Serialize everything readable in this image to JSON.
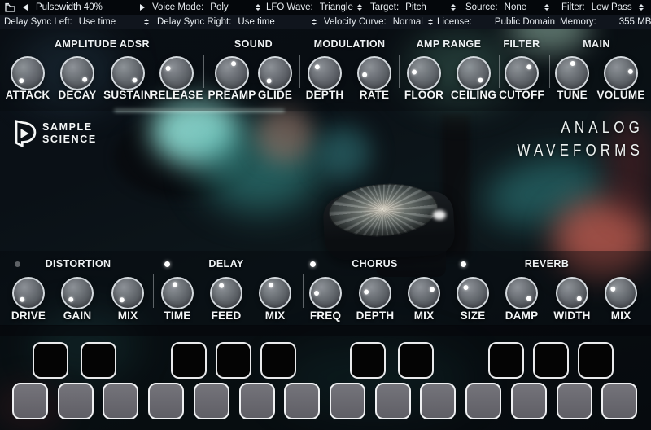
{
  "header": {
    "preset": {
      "name": "Pulsewidth 40%"
    },
    "row1_selects": [
      {
        "label": "Voice Mode:",
        "value": "Poly"
      },
      {
        "label": "LFO Wave:",
        "value": "Triangle"
      },
      {
        "label": "Target:",
        "value": "Pitch"
      },
      {
        "label": "Source:",
        "value": "None"
      },
      {
        "label": "Filter:",
        "value": "Low Pass"
      }
    ],
    "row2_selects": [
      {
        "label": "Delay Sync Left:",
        "value": "Use time"
      },
      {
        "label": "Delay Sync Right:",
        "value": "Use time"
      },
      {
        "label": "Velocity Curve:",
        "value": "Normal"
      }
    ],
    "row2_info": [
      {
        "label": "License:",
        "value": "Public Domain"
      },
      {
        "label": "Memory:",
        "value": "355 MB"
      }
    ]
  },
  "branding": {
    "logo_line1": "SAMPLE",
    "logo_line2": "SCIENCE",
    "product_line1": "ANALOG",
    "product_line2": "WAVEFORMS"
  },
  "top_sections": [
    {
      "title": "AMPLITUDE ADSR",
      "knobs": [
        {
          "label": "ATTACK",
          "angle": 220
        },
        {
          "label": "DECAY",
          "angle": 130
        },
        {
          "label": "SUSTAIN",
          "angle": 135
        },
        {
          "label": "RELEASE",
          "angle": 300
        }
      ]
    },
    {
      "title": "SOUND",
      "knobs": [
        {
          "label": "PREAMP",
          "angle": 10
        },
        {
          "label": "GLIDE",
          "angle": 218
        }
      ]
    },
    {
      "title": "MODULATION",
      "knobs": [
        {
          "label": "DEPTH",
          "angle": 310
        },
        {
          "label": "RATE",
          "angle": 261
        }
      ]
    },
    {
      "title": "AMP RANGE",
      "knobs": [
        {
          "label": "FLOOR",
          "angle": 277
        },
        {
          "label": "CEILING",
          "angle": 135
        }
      ]
    },
    {
      "title": "FILTER",
      "knobs": [
        {
          "label": "CUTOFF",
          "angle": 50
        }
      ]
    },
    {
      "title": "MAIN",
      "knobs": [
        {
          "label": "TUNE",
          "angle": 4
        },
        {
          "label": "VOLUME",
          "angle": 80
        }
      ]
    }
  ],
  "fx_sections": [
    {
      "title": "DISTORTION",
      "led": "off",
      "knobs": [
        {
          "label": "DRIVE",
          "angle": 225
        },
        {
          "label": "GAIN",
          "angle": 225
        },
        {
          "label": "MIX",
          "angle": 221
        }
      ]
    },
    {
      "title": "DELAY",
      "led": "on",
      "knobs": [
        {
          "label": "TIME",
          "angle": 344
        },
        {
          "label": "FEED",
          "angle": 328
        },
        {
          "label": "MIX",
          "angle": 333
        }
      ]
    },
    {
      "title": "CHORUS",
      "led": "on",
      "knobs": [
        {
          "label": "FREQ",
          "angle": 270
        },
        {
          "label": "DEPTH",
          "angle": 278
        },
        {
          "label": "MIX",
          "angle": 65
        }
      ]
    },
    {
      "title": "REVERB",
      "led": "on",
      "knobs": [
        {
          "label": "SIZE",
          "angle": 309
        },
        {
          "label": "DAMP",
          "angle": 126
        },
        {
          "label": "WIDTH",
          "angle": 127
        },
        {
          "label": "MIX",
          "angle": 298
        }
      ]
    }
  ],
  "keyboard": {
    "white_keys": 14,
    "black_keys": 10
  },
  "colors": {
    "led_on": "#ffffff",
    "led_off": "#5d6165",
    "knob_ring": "#dde3e7",
    "accent_teal": "#3aa79f"
  }
}
